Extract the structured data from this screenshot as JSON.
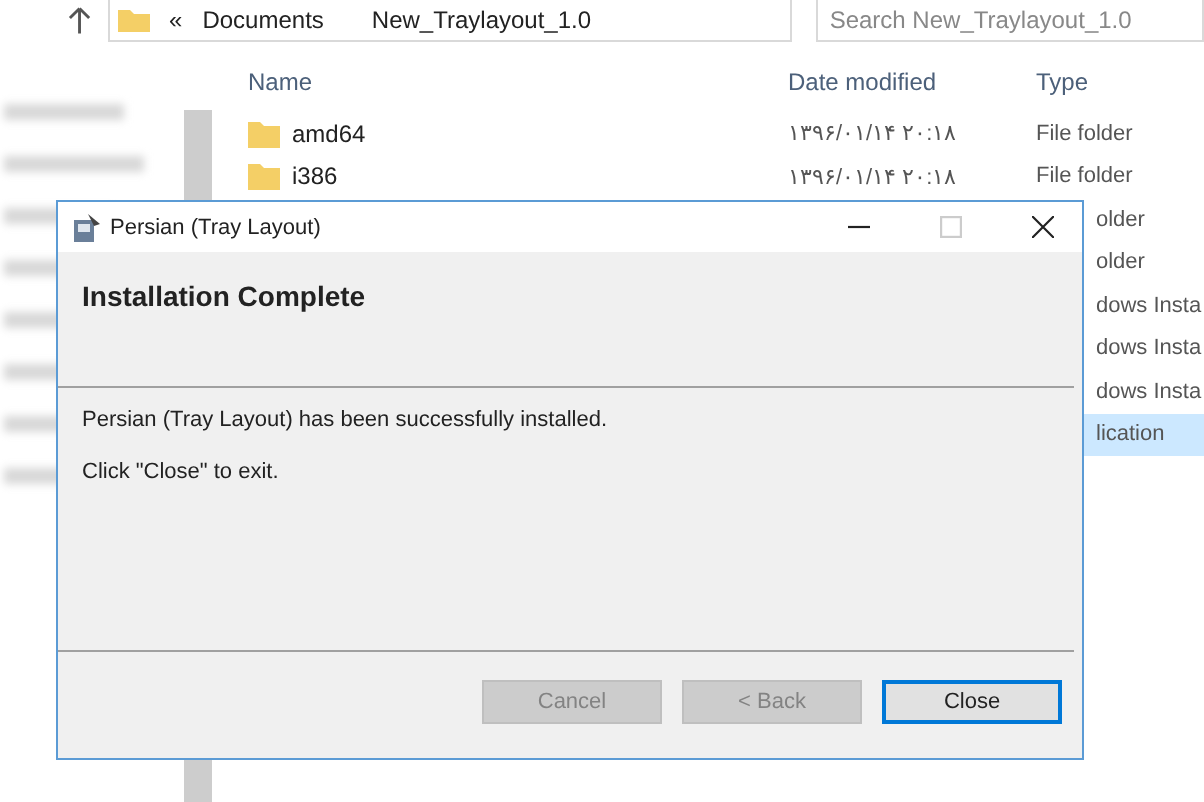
{
  "explorer": {
    "breadcrumb": [
      "«",
      "Documents",
      "New_Traylayout_1.0"
    ],
    "search": {
      "placeholder": "Search New_Traylayout_1.0"
    },
    "columns": [
      "Name",
      "Date modified",
      "Type"
    ],
    "rows": [
      {
        "kind": "full",
        "name": "amd64",
        "date": "۱۳۹۶/۰۱/۱۴ ۲۰:۱۸",
        "type": "File folder",
        "selected": false
      },
      {
        "kind": "full",
        "name": "i386",
        "date": "۱۳۹۶/۰۱/۱۴ ۲۰:۱۸",
        "type": "File folder",
        "selected": false
      },
      {
        "kind": "covered",
        "type": "older",
        "selected": false
      },
      {
        "kind": "covered",
        "type": "older",
        "selected": false
      },
      {
        "kind": "covered",
        "type": "dows Insta",
        "selected": false
      },
      {
        "kind": "covered",
        "type": "dows Insta",
        "selected": false
      },
      {
        "kind": "covered",
        "type": "dows Insta",
        "selected": false
      },
      {
        "kind": "covered",
        "type": "lication",
        "selected": true
      }
    ]
  },
  "dialog": {
    "title": "Persian (Tray Layout)",
    "heading": "Installation Complete",
    "messages": [
      "Persian (Tray Layout) has been successfully installed.",
      "Click \"Close\" to exit."
    ],
    "buttons": [
      {
        "label": "Cancel",
        "disabled": true,
        "default": false
      },
      {
        "label": "< Back",
        "disabled": true,
        "default": false
      },
      {
        "label": "Close",
        "disabled": false,
        "default": true
      }
    ]
  }
}
